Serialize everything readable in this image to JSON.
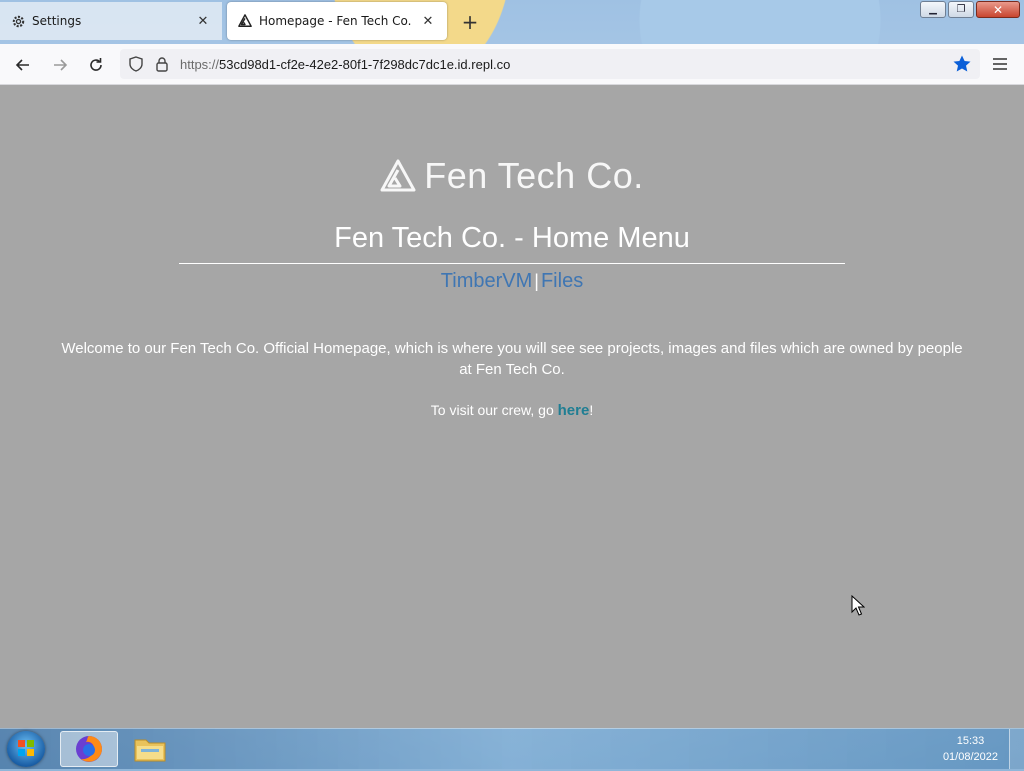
{
  "browser": {
    "tabs": [
      {
        "title": "Settings",
        "icon": "gear-icon",
        "active": false
      },
      {
        "title": "Homepage - Fen Tech Co.",
        "icon": "fentech-logo-icon",
        "active": true
      }
    ],
    "url_scheme": "https://",
    "url_host": "53cd98d1-cf2e-42e2-80f1-7f298dc7dc1e.id.repl.co",
    "bookmark_star_color": "#0b5fd8"
  },
  "page": {
    "brand_name": "Fen Tech Co.",
    "title": "Fen Tech Co. - Home Menu",
    "nav_links": [
      {
        "label": "TimberVM"
      },
      {
        "label": "Files"
      }
    ],
    "nav_separator": "|",
    "welcome_text": "Welcome to our Fen Tech Co. Official Homepage, which is where you will see see projects, images and files which are owned by people at Fen Tech Co.",
    "crew_prefix": "To visit our crew, go ",
    "crew_link": "here",
    "crew_suffix": "!",
    "background_color": "#a6a6a6",
    "link_color": "#3f76b3"
  },
  "taskbar": {
    "time": "15:33",
    "date": "01/08/2022"
  }
}
